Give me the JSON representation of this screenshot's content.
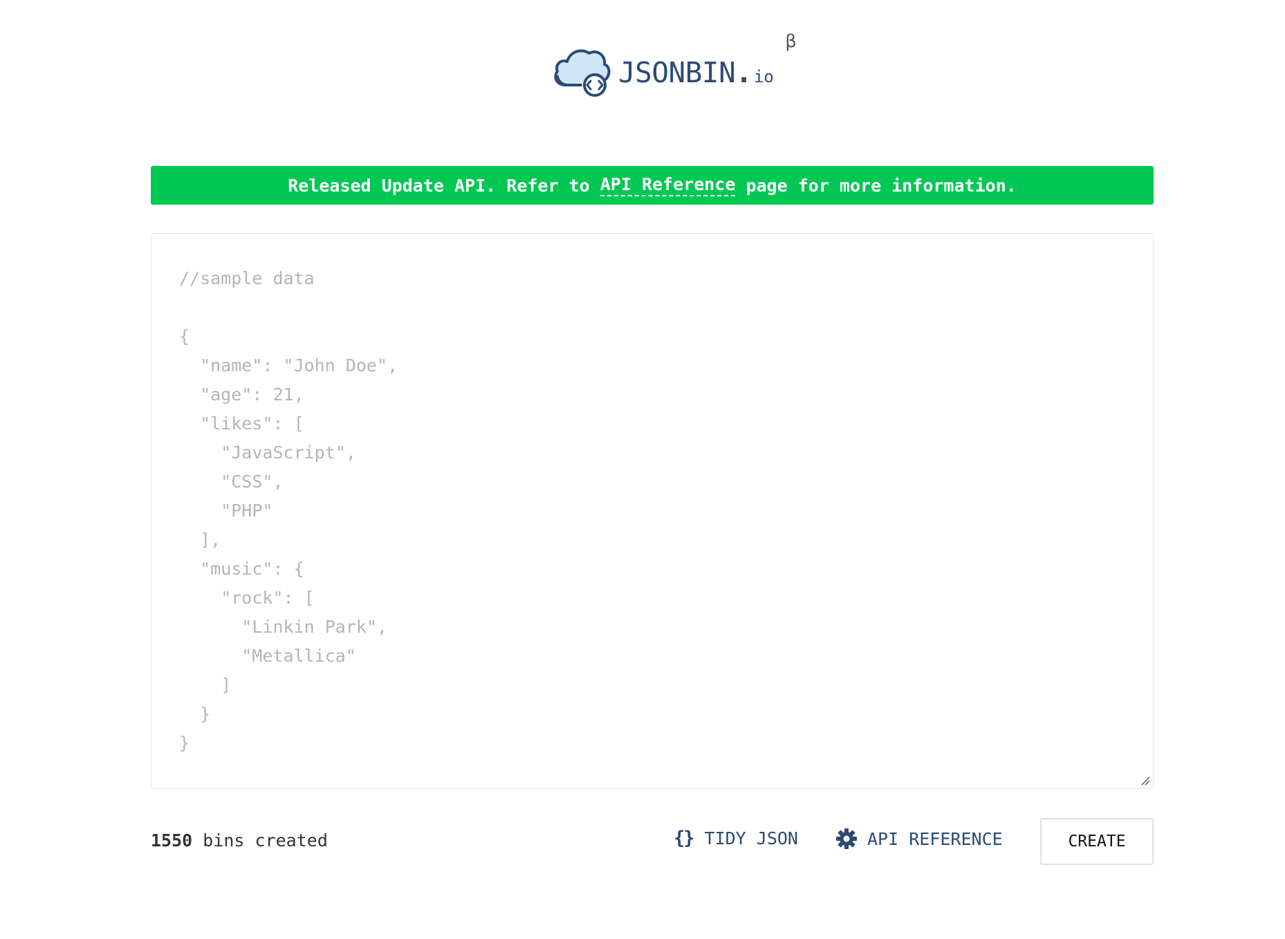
{
  "header": {
    "logo_name": "JSONBIN",
    "logo_dot": ".",
    "logo_tld": "io",
    "logo_beta": "β",
    "logo_icon": "cloud-code-icon"
  },
  "banner": {
    "text_before": "Released Update API. Refer to ",
    "link_text": "API Reference",
    "text_after": " page for more information.",
    "color": "#00c853"
  },
  "editor": {
    "placeholder_lines": [
      "//sample data",
      "",
      "{",
      "  \"name\": \"John Doe\",",
      "  \"age\": 21,",
      "  \"likes\": [",
      "    \"JavaScript\",",
      "    \"CSS\",",
      "    \"PHP\"",
      "  ],",
      "  \"music\": {",
      "    \"rock\": [",
      "      \"Linkin Park\",",
      "      \"Metallica\"",
      "    ]",
      "  }",
      "}"
    ],
    "text_color": "#b5b5b5"
  },
  "footer": {
    "bins_number": "1550",
    "bins_label": " bins created",
    "tidy_icon": "braces-icon",
    "tidy_braces": "{}",
    "tidy_label": "TIDY JSON",
    "api_icon": "gear-icon",
    "api_label": "API REFERENCE",
    "create_label": "CREATE",
    "accent_color": "#2c4a73"
  }
}
